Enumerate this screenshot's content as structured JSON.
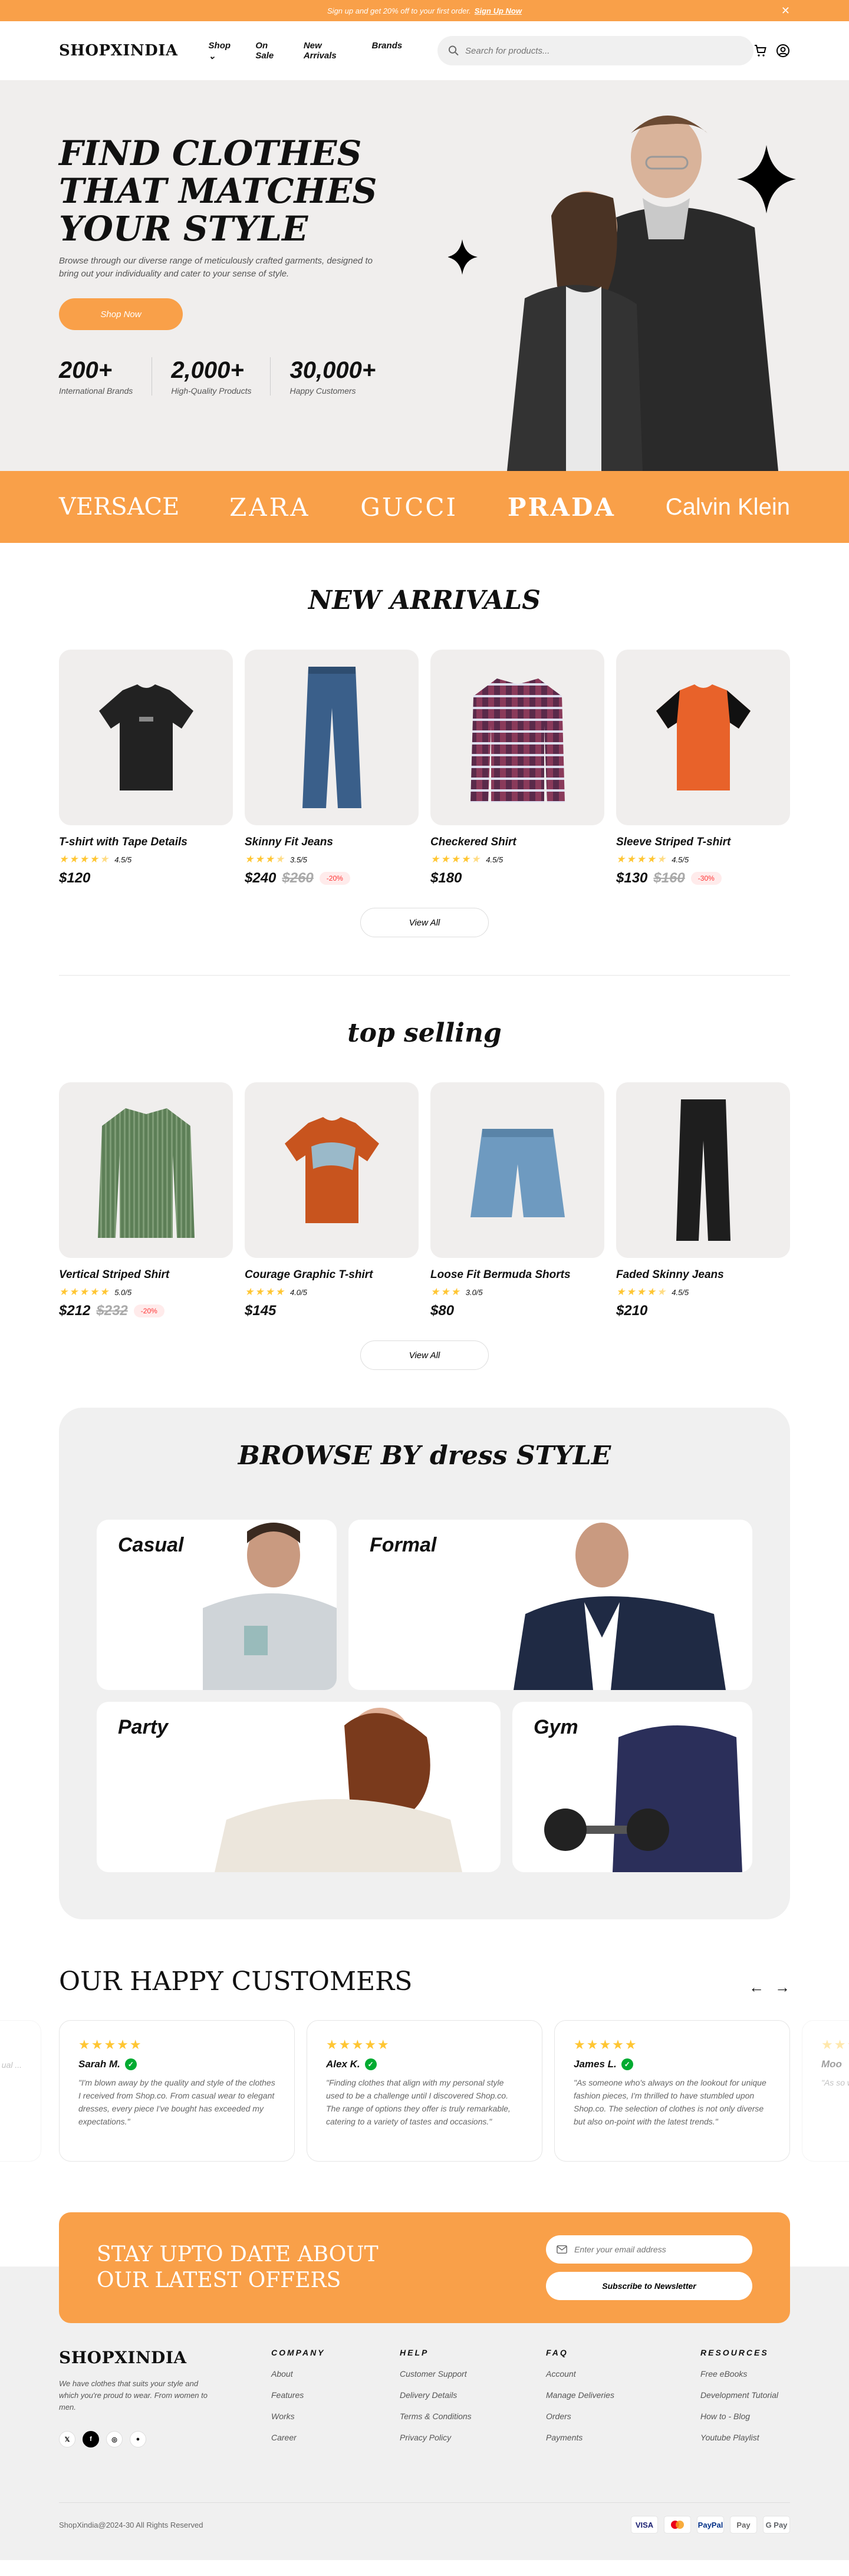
{
  "topbar": {
    "text": "Sign up and get 20% off to your first order.",
    "link": "Sign Up Now",
    "close": "✕"
  },
  "nav": {
    "logo": "SHOPXINDIA",
    "items": [
      "Shop",
      "On Sale",
      "New Arrivals",
      "Brands"
    ],
    "search_placeholder": "Search for products..."
  },
  "hero": {
    "title": "FIND CLOTHES THAT MATCHES YOUR STYLE",
    "subtitle": "Browse through our diverse range of meticulously crafted garments, designed to bring out your individuality and cater to your sense of style.",
    "cta": "Shop Now",
    "stats": [
      {
        "value": "200+",
        "label": "International Brands"
      },
      {
        "value": "2,000+",
        "label": "High-Quality Products"
      },
      {
        "value": "30,000+",
        "label": "Happy Customers"
      }
    ]
  },
  "brands": [
    "VERSACE",
    "ZARA",
    "GUCCI",
    "PRADA",
    "Calvin Klein"
  ],
  "new_arrivals": {
    "title": "NEW ARRIVALS",
    "view_all": "View All",
    "products": [
      {
        "name": "T-shirt with Tape Details",
        "rating": "4.5/5",
        "price": "$120",
        "old": "",
        "off": ""
      },
      {
        "name": "Skinny Fit Jeans",
        "rating": "3.5/5",
        "price": "$240",
        "old": "$260",
        "off": "-20%"
      },
      {
        "name": "Checkered Shirt",
        "rating": "4.5/5",
        "price": "$180",
        "old": "",
        "off": ""
      },
      {
        "name": "Sleeve Striped T-shirt",
        "rating": "4.5/5",
        "price": "$130",
        "old": "$160",
        "off": "-30%"
      }
    ]
  },
  "top_selling": {
    "title": "top selling",
    "view_all": "View All",
    "products": [
      {
        "name": "Vertical Striped Shirt",
        "rating": "5.0/5",
        "price": "$212",
        "old": "$232",
        "off": "-20%"
      },
      {
        "name": "Courage Graphic T-shirt",
        "rating": "4.0/5",
        "price": "$145",
        "old": "",
        "off": ""
      },
      {
        "name": "Loose Fit Bermuda Shorts",
        "rating": "3.0/5",
        "price": "$80",
        "old": "",
        "off": ""
      },
      {
        "name": "Faded Skinny Jeans",
        "rating": "4.5/5",
        "price": "$210",
        "old": "",
        "off": ""
      }
    ]
  },
  "browse": {
    "title": "BROWSE BY dress STYLE",
    "styles": [
      "Casual",
      "Formal",
      "Party",
      "Gym"
    ]
  },
  "customers": {
    "title": "OUR HAPPY CUSTOMERS",
    "reviews": [
      {
        "name": "Sarah M.",
        "text": "\"I'm blown away by the quality and style of the clothes I received from Shop.co. From casual wear to elegant dresses, every piece I've bought has exceeded my expectations.\""
      },
      {
        "name": "Alex K.",
        "text": "\"Finding clothes that align with my personal style used to be a challenge until I discovered Shop.co. The range of options they offer is truly remarkable, catering to a variety of tastes and occasions.\""
      },
      {
        "name": "James L.",
        "text": "\"As someone who's always on the lookout for unique fashion pieces, I'm thrilled to have stumbled upon Shop.co. The selection of clothes is not only diverse but also on-point with the latest trends.\""
      },
      {
        "name": "Moo",
        "text": "\"As so with th stumb clothe ..."
      },
      {
        "name": "",
        "text": "of the ual ..."
      }
    ]
  },
  "newsletter": {
    "title": "STAY UPTO DATE ABOUT OUR LATEST OFFERS",
    "placeholder": "Enter your email address",
    "button": "Subscribe to Newsletter"
  },
  "footer": {
    "logo": "SHOPXINDIA",
    "desc": "We have clothes that suits your style and which you're proud to wear. From women to men.",
    "columns": [
      {
        "title": "COMPANY",
        "links": [
          "About",
          "Features",
          "Works",
          "Career"
        ]
      },
      {
        "title": "HELP",
        "links": [
          "Customer Support",
          "Delivery Details",
          "Terms & Conditions",
          "Privacy Policy"
        ]
      },
      {
        "title": "FAQ",
        "links": [
          "Account",
          "Manage Deliveries",
          "Orders",
          "Payments"
        ]
      },
      {
        "title": "RESOURCES",
        "links": [
          "Free eBooks",
          "Development Tutorial",
          "How to - Blog",
          "Youtube Playlist"
        ]
      }
    ],
    "copyright": "ShopXindia@2024-30 All Rights Reserved",
    "payments": [
      "VISA",
      "MC",
      "PayPal",
      "Pay",
      "G Pay"
    ]
  },
  "colors": {
    "accent": "#F9A049",
    "hero_bg": "#F0EEED",
    "star": "#FFC633"
  }
}
